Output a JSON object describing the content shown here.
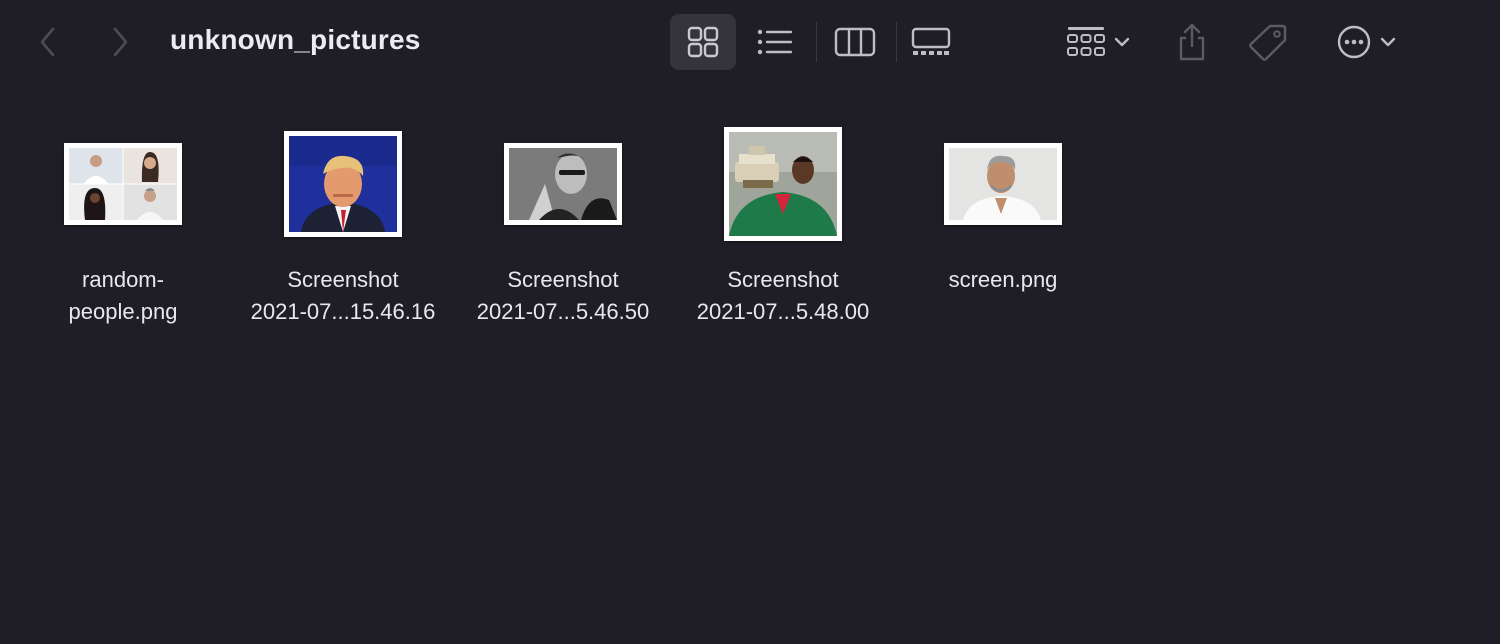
{
  "window": {
    "title": "unknown_pictures"
  },
  "toolbar": {
    "back_icon": "chevron-left-icon",
    "forward_icon": "chevron-right-icon",
    "views": [
      {
        "name": "icon-view",
        "icon": "grid-icon",
        "active": true
      },
      {
        "name": "list-view",
        "icon": "list-icon",
        "active": false
      },
      {
        "name": "column-view",
        "icon": "columns-icon",
        "active": false
      },
      {
        "name": "gallery-view",
        "icon": "gallery-icon",
        "active": false
      }
    ],
    "group_icon": "group-by-icon",
    "share_icon": "share-icon",
    "tag_icon": "tag-icon",
    "more_icon": "ellipsis-circle-icon"
  },
  "files": [
    {
      "line1": "random-",
      "line2": "people.png",
      "thumbnail": "collage of four portraits"
    },
    {
      "line1": "Screenshot",
      "line2": "2021-07...15.46.16",
      "thumbnail": "portrait on blue background"
    },
    {
      "line1": "Screenshot",
      "line2": "2021-07...5.46.50",
      "thumbnail": "black and white portrait"
    },
    {
      "line1": "Screenshot",
      "line2": "2021-07...5.48.00",
      "thumbnail": "person in green jacket holding trophy"
    },
    {
      "line1": "screen.png",
      "line2": "",
      "thumbnail": "portrait on light background"
    }
  ],
  "colors": {
    "background": "#1f1e26",
    "active_view_bg": "#35343c",
    "icon": "#bdbdc3",
    "icon_dim": "#5c5b63"
  }
}
